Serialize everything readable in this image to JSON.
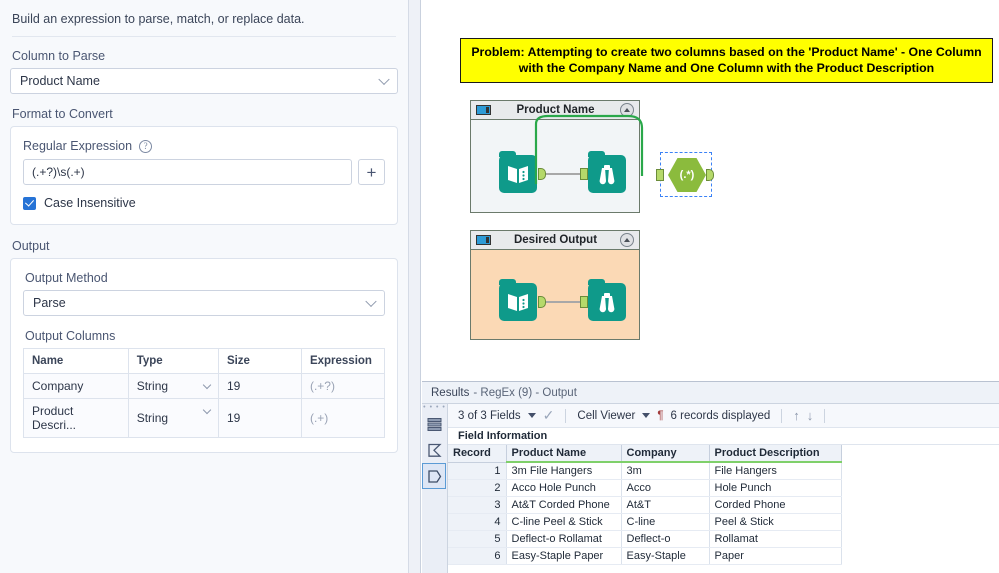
{
  "config": {
    "intro": "Build an expression to parse, match, or replace data.",
    "column_to_parse_label": "Column to Parse",
    "column_to_parse_value": "Product Name",
    "format_to_convert_label": "Format to Convert",
    "regex_label": "Regular Expression",
    "regex_value": "(.+?)\\s(.+)",
    "help_glyph": "?",
    "plus_glyph": "+",
    "case_insensitive_label": "Case Insensitive",
    "output_label": "Output",
    "output_method_label": "Output Method",
    "output_method_value": "Parse",
    "output_columns_label": "Output Columns",
    "output_columns_headers": [
      "Name",
      "Type",
      "Size",
      "Expression"
    ],
    "output_columns_rows": [
      {
        "name": "Company",
        "type": "String",
        "size": "19",
        "expression": "(.+?)"
      },
      {
        "name": "Product Descri...",
        "type": "String",
        "size": "19",
        "expression": "(.+)"
      }
    ]
  },
  "canvas": {
    "note": "Problem:  Attempting to create two columns based on the 'Product Name' - One Column with the Company Name and One Column with the Product Description",
    "containers": [
      {
        "title": "Product Name",
        "fill": "#f2f5f7"
      },
      {
        "title": "Desired Output",
        "fill": "#fbd9b5"
      }
    ],
    "regex_node_label": "(.*)"
  },
  "results": {
    "title_prefix": "Results",
    "title_body": "- RegEx (9) - Output",
    "fields_selector": "3 of 3 Fields",
    "viewer_selector": "Cell Viewer",
    "pilcrow": "¶",
    "records_displayed": "6 records displayed",
    "up_arrow": "↑",
    "down_arrow": "↓",
    "check_glyph": "✓",
    "field_information": "Field Information",
    "grid_headers": [
      "Record",
      "Product Name",
      "Company",
      "Product Description"
    ],
    "grid_rows": [
      {
        "record": "1",
        "product_name": "3m File Hangers",
        "company": "3m",
        "product_description": "File Hangers"
      },
      {
        "record": "2",
        "product_name": "Acco Hole Punch",
        "company": "Acco",
        "product_description": "Hole Punch"
      },
      {
        "record": "3",
        "product_name": "At&T Corded Phone",
        "company": "At&T",
        "product_description": "Corded Phone"
      },
      {
        "record": "4",
        "product_name": "C-line Peel & Stick",
        "company": "C-line",
        "product_description": "Peel & Stick"
      },
      {
        "record": "5",
        "product_name": "Deflect-o Rollamat",
        "company": "Deflect-o",
        "product_description": "Rollamat"
      },
      {
        "record": "6",
        "product_name": "Easy-Staple Paper",
        "company": "Easy-Staple",
        "product_description": "Paper"
      }
    ]
  },
  "colors": {
    "accent_blue": "#2673d6",
    "tool_teal": "#0f9a8a",
    "regex_green": "#8bbb3d",
    "note_yellow": "#ffff00",
    "header_underline_green": "#7fd06a",
    "container_desired_fill": "#fbd9b5"
  }
}
